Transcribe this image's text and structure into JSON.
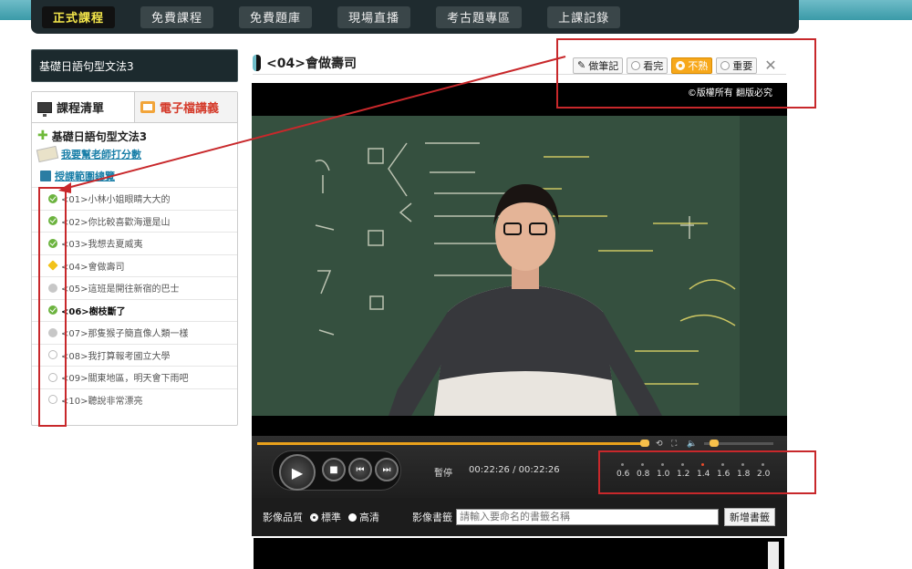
{
  "nav": {
    "tabs": [
      "正式課程",
      "免費課程",
      "免費題庫",
      "現場直播",
      "考古題專區",
      "上課記錄"
    ],
    "active": 0
  },
  "course": {
    "name": "基礎日語句型文法3"
  },
  "sidebar": {
    "tab_list": "課程清單",
    "tab_pdf": "電子檔講義",
    "tree_title": "基礎日語句型文法3",
    "rate_link": "我要幫老師打分數",
    "outline_link": "授課範圍總覽",
    "lessons": [
      {
        "label": "<01>小林小姐眼睛大大的",
        "status": "done"
      },
      {
        "label": "<02>你比較喜歡海還是山",
        "status": "done"
      },
      {
        "label": "<03>我想去夏威夷",
        "status": "done"
      },
      {
        "label": "<04>會做壽司",
        "status": "unsure"
      },
      {
        "label": "<05>這班是開往新宿的巴士",
        "status": "watched"
      },
      {
        "label": "<06>樹枝斷了",
        "status": "done"
      },
      {
        "label": "<07>那隻猴子簡直像人類一樣",
        "status": "watched"
      },
      {
        "label": "<08>我打算報考國立大學",
        "status": "none"
      },
      {
        "label": "<09>關東地區，明天會下雨吧",
        "status": "none"
      },
      {
        "label": "<10>聽說非常漂亮",
        "status": "none"
      }
    ]
  },
  "lesson": {
    "title": "<04>會做壽司"
  },
  "toolbar": {
    "note": "做筆記",
    "watched": "看完",
    "unsure": "不熟",
    "important": "重要",
    "close": "✕"
  },
  "video": {
    "copyright": "©版權所有 翻版必究"
  },
  "player": {
    "status": "暫停",
    "time": "00:22:26 / 00:22:26",
    "progress": 1.0,
    "speeds": [
      "0.6",
      "0.8",
      "1.0",
      "1.2",
      "1.4",
      "1.6",
      "1.8",
      "2.0"
    ],
    "current_speed": "1.4"
  },
  "options": {
    "quality_label": "影像品質",
    "quality_standard": "標準",
    "quality_hd": "高清",
    "bookmark_label": "影像書籤",
    "bookmark_placeholder": "請輸入要命名的書籤名稱",
    "add_bookmark": "新增書籤"
  },
  "colors": {
    "accent": "#f7a81b",
    "done": "#6cb33f",
    "highlight": "#c8282b"
  }
}
